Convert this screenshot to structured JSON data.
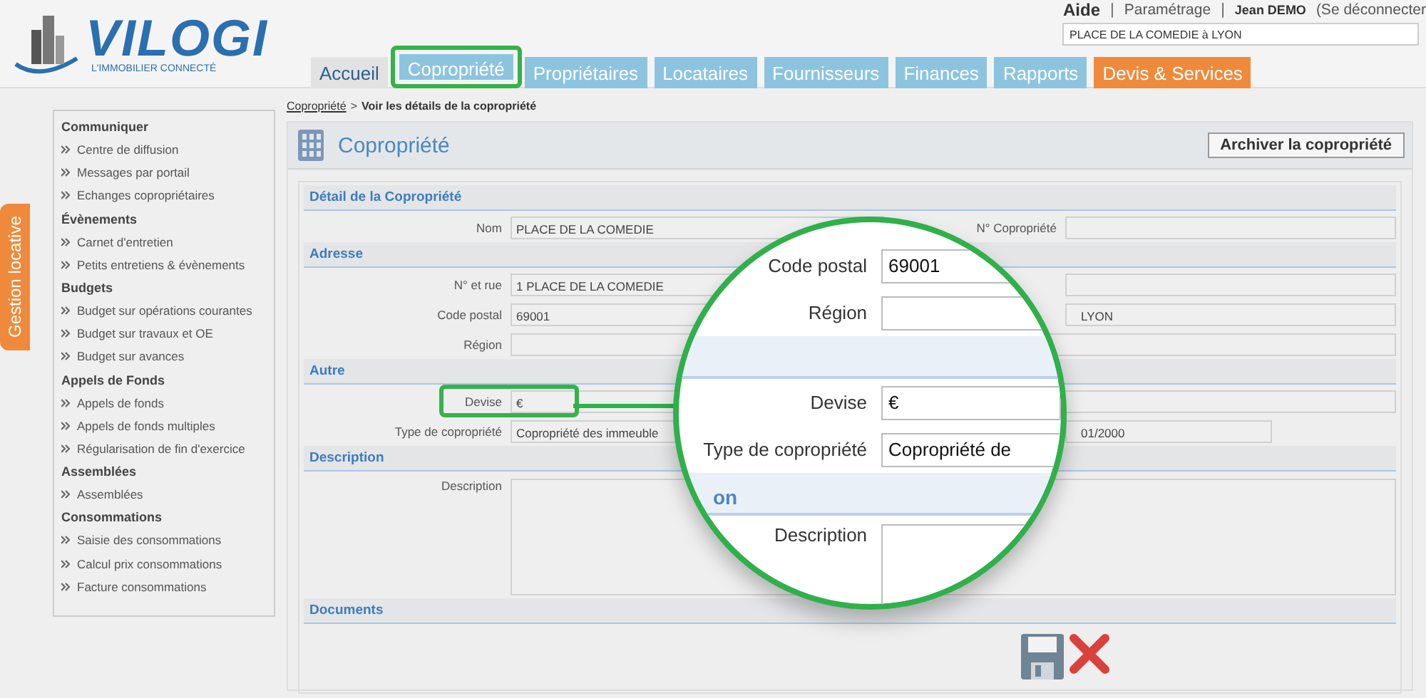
{
  "logo": {
    "name": "VILOGI",
    "tagline": "L'IMMOBILIER CONNECTÉ"
  },
  "top_links": [
    {
      "text": "Aide",
      "kind": "strong"
    },
    {
      "text": "|",
      "kind": "separator"
    },
    {
      "text": "Paramétrage",
      "kind": "link"
    },
    {
      "text": "|",
      "kind": "separator"
    },
    {
      "text": "Jean DEMO",
      "kind": "user"
    },
    {
      "text": "(Se déconnecter",
      "kind": "link"
    }
  ],
  "search": {
    "value": "PLACE DE LA COMEDIE à LYON"
  },
  "tabs": [
    {
      "label": "Accueil",
      "kind": "home",
      "highlighted": false
    },
    {
      "label": "Copropriété",
      "kind": "normal",
      "highlighted": true
    },
    {
      "label": "Propriétaires",
      "kind": "normal",
      "highlighted": false
    },
    {
      "label": "Locataires",
      "kind": "normal",
      "highlighted": false
    },
    {
      "label": "Fournisseurs",
      "kind": "normal",
      "highlighted": false
    },
    {
      "label": "Finances",
      "kind": "normal",
      "highlighted": false
    },
    {
      "label": "Rapports",
      "kind": "normal",
      "highlighted": false
    },
    {
      "label": "Devis & Services",
      "kind": "accent",
      "highlighted": false
    }
  ],
  "side_tab": {
    "label": "Gestion locative"
  },
  "sidebar": {
    "groups": [
      {
        "title": "Communiquer",
        "items": [
          "Centre de diffusion",
          "Messages par portail",
          "Echanges copropriétaires"
        ]
      },
      {
        "title": "Évènements",
        "items": [
          "Carnet d'entretien",
          "Petits entretiens & évènements"
        ]
      },
      {
        "title": "Budgets",
        "items": [
          "Budget sur opérations courantes",
          "Budget sur travaux et OE",
          "Budget sur avances"
        ]
      },
      {
        "title": "Appels de Fonds",
        "items": [
          "Appels de fonds",
          "Appels de fonds multiples",
          "Régularisation de fin d'exercice"
        ]
      },
      {
        "title": "Assemblées",
        "items": [
          "Assemblées"
        ]
      },
      {
        "title": "Consommations",
        "items": [
          "Saisie des consommations",
          "Calcul prix consommations",
          "Facture consommations"
        ]
      }
    ]
  },
  "breadcrumb": {
    "link": "Copropriété",
    "separator": ">",
    "current": "Voir les détails de la copropriété"
  },
  "panel": {
    "title": "Copropriété",
    "archive_button": "Archiver la copropriété"
  },
  "sections": [
    {
      "title": "Détail de la Copropriété",
      "rows": [
        {
          "kind": "pair",
          "label": "Nom",
          "value": "PLACE DE LA COMEDIE",
          "right_label": "N° Copropriété",
          "highlighted": false
        }
      ]
    },
    {
      "title": "Adresse",
      "rows": [
        {
          "kind": "pair",
          "label": "N° et rue",
          "value": "1 PLACE DE LA COMEDIE",
          "highlighted": false
        },
        {
          "kind": "pair",
          "label": "Code postal",
          "value": "69001",
          "right_value": "LYON",
          "highlighted": false
        },
        {
          "kind": "wide",
          "label": "Région",
          "highlighted": false
        }
      ]
    },
    {
      "title": "Autre",
      "rows": [
        {
          "kind": "wide",
          "label": "Devise",
          "value": "€",
          "highlighted": true
        },
        {
          "kind": "pair_short",
          "label": "Type de copropriété",
          "value": "Copropriété des immeuble",
          "right_value": "01/2000",
          "highlighted": false
        }
      ]
    },
    {
      "title": "Description",
      "rows": [
        {
          "kind": "textarea",
          "label": "Description",
          "highlighted": false
        }
      ]
    },
    {
      "title": "Documents",
      "rows": [
        {
          "kind": "actions",
          "highlighted": false
        }
      ]
    }
  ],
  "magnifier": {
    "rows": [
      {
        "kind": "field",
        "label": "Code postal",
        "value": "69001"
      },
      {
        "kind": "field",
        "label": "Région"
      },
      {
        "kind": "band"
      },
      {
        "kind": "field",
        "label": "Devise",
        "value": "€"
      },
      {
        "kind": "field",
        "label": "Type de copropriété",
        "value": "Copropriété de"
      },
      {
        "kind": "band",
        "title": "on"
      },
      {
        "kind": "textarea",
        "label": "Description"
      }
    ]
  }
}
